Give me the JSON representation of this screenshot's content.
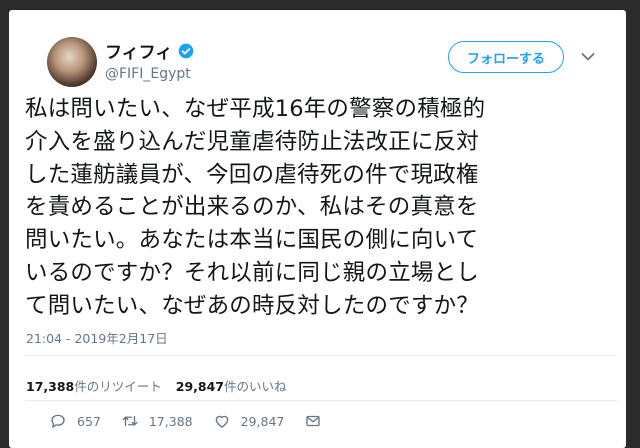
{
  "user": {
    "name": "フィフィ",
    "handle": "@FIFI_Egypt"
  },
  "follow_label": "フォローする",
  "tweet_text": "私は問いたい、なぜ平成16年の警察の積極的\n介入を盛り込んだ児童虐待防止法改正に反対\nした蓮舫議員が、今回の虐待死の件で現政権\nを責めることが出来るのか、私はその真意を\n問いたい。あなたは本当に国民の側に向いて\nいるのですか？それ以前に同じ親の立場とし\nて問いたい、なぜあの時反対したのですか？",
  "timestamp": "21:04 - 2019年2月17日",
  "stats": {
    "retweet_count": "17,388",
    "retweet_label": "件のリツイート",
    "like_count": "29,847",
    "like_label": "件のいいね"
  },
  "actions": {
    "reply_count": "657",
    "retweet_count": "17,388",
    "like_count": "29,847"
  },
  "colors": {
    "accent": "#1da1f2",
    "muted": "#657786",
    "text": "#14171a"
  }
}
